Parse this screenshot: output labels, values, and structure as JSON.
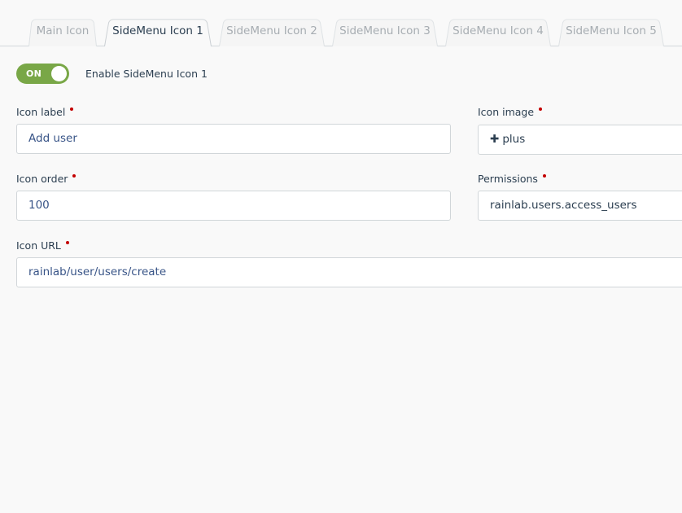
{
  "tabs": [
    {
      "label": "Main Icon",
      "active": false
    },
    {
      "label": "SideMenu Icon 1",
      "active": true
    },
    {
      "label": "SideMenu Icon 2",
      "active": false
    },
    {
      "label": "SideMenu Icon 3",
      "active": false
    },
    {
      "label": "SideMenu Icon 4",
      "active": false
    },
    {
      "label": "SideMenu Icon 5",
      "active": false
    }
  ],
  "toggle": {
    "state_label": "ON",
    "label": "Enable SideMenu Icon 1",
    "accent_color": "#79a747"
  },
  "fields": {
    "icon_label": {
      "label": "Icon label",
      "value": "Add user"
    },
    "icon_image": {
      "label": "Icon image",
      "value": "plus",
      "icon": "plus-icon"
    },
    "icon_order": {
      "label": "Icon order",
      "value": "100"
    },
    "permissions": {
      "label": "Permissions",
      "value": "rainlab.users.access_users"
    },
    "icon_url": {
      "label": "Icon URL",
      "value": "rainlab/user/users/create"
    }
  },
  "colors": {
    "required_marker": "#c30000",
    "input_text": "#385487"
  }
}
